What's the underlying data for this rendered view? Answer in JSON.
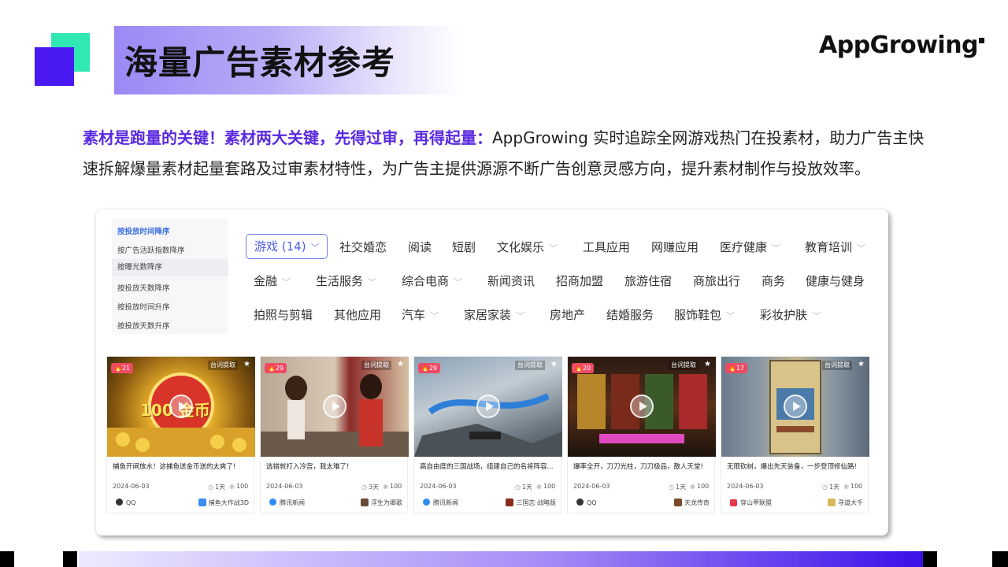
{
  "header": {
    "title": "海量广告素材参考",
    "logo_text": "AppGrowing"
  },
  "intro": {
    "highlight": "素材是跑量的关键！素材两大关键，先得过审，再得起量：",
    "body": "AppGrowing 实时追踪全网游戏热门在投素材，助力广告主快速拆解爆量素材起量套路及过审素材特性，为广告主提供源源不断广告创意灵感方向，提升素材制作与投放效率。"
  },
  "sort_options": [
    "按投放时间降序",
    "按广告活跃指数降序",
    "按曝光数降序",
    "按投放天数降序",
    "按投放时间升序",
    "按投放天数升序"
  ],
  "categories": {
    "selected": "游戏 (14)",
    "row1": [
      "社交婚恋",
      "阅读",
      "短剧",
      "文化娱乐",
      "工具应用",
      "网赚应用",
      "医疗健康",
      "教育培训"
    ],
    "row2": [
      "金融",
      "生活服务",
      "综合电商",
      "新闻资讯",
      "招商加盟",
      "旅游住宿",
      "商旅出行",
      "商务",
      "健康与健身"
    ],
    "row3": [
      "拍照与剪辑",
      "其他应用",
      "汽车",
      "家居家装",
      "房地产",
      "结婚服务",
      "服饰鞋包",
      "彩妆护肤"
    ]
  },
  "ad_card_labels": {
    "extract": "台词提取",
    "star_icon": "star-icon"
  },
  "ads": [
    {
      "heat": "21",
      "caption": "捕鱼开闸放水！这捕鱼送金币送的太爽了!",
      "date": "2024-06-03",
      "duration": "1天",
      "views": "100",
      "platform": "QQ",
      "app": "捕鱼大作战3D",
      "thumb_text": "100 金币"
    },
    {
      "heat": "29",
      "caption": "选错就打入冷宫，我太难了!",
      "date": "2024-06-03",
      "duration": "3天",
      "views": "100",
      "platform": "腾讯新闻",
      "app": "浮生为卿歌",
      "thumb_text": ""
    },
    {
      "heat": "29",
      "caption": "高自由度的三国战场，组建自己的名将阵容...",
      "date": "2024-06-03",
      "duration": "1天",
      "views": "100",
      "platform": "腾讯新闻",
      "app": "三国志·战略版",
      "thumb_text": ""
    },
    {
      "heat": "20",
      "caption": "爆率全开，刀刀光柱，刀刀极品，散人天堂!",
      "date": "2024-06-03",
      "duration": "1天",
      "views": "100",
      "platform": "QQ",
      "app": "天龙传奇",
      "thumb_text": ""
    },
    {
      "heat": "17",
      "caption": "无限砍树，爆出先天装备，一步登顶修仙路!",
      "date": "2024-06-03",
      "duration": "1天",
      "views": "100",
      "platform": "穿山甲联盟",
      "app": "寻道大千",
      "thumb_text": ""
    }
  ],
  "colors": {
    "accent_purple": "#4a19f2",
    "accent_green": "#2fe8b4",
    "highlight_text": "#5a2ae0",
    "heat_badge": "#ef4a64",
    "selected_category": "#4b5fe3"
  }
}
